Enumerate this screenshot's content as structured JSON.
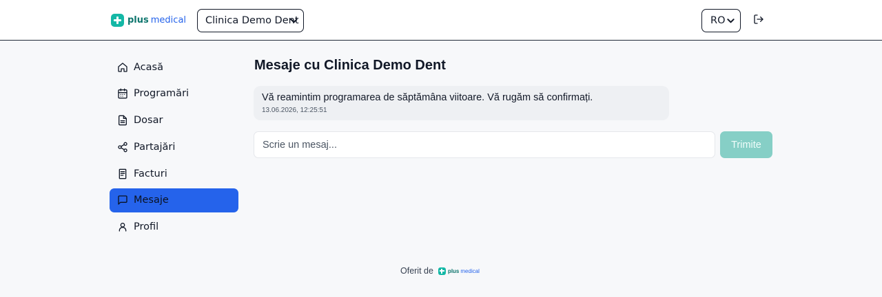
{
  "header": {
    "logo_plus": "plus",
    "logo_medical": "medical",
    "clinic_selected": "Clinica Demo Dent",
    "language_selected": "RO",
    "logout_icon": "logout-icon"
  },
  "sidebar": {
    "items": [
      {
        "label": "Acasă",
        "icon": "home-icon",
        "active": false
      },
      {
        "label": "Programări",
        "icon": "calendar-icon",
        "active": false
      },
      {
        "label": "Dosar",
        "icon": "document-icon",
        "active": false
      },
      {
        "label": "Partajări",
        "icon": "share-icon",
        "active": false
      },
      {
        "label": "Facturi",
        "icon": "invoice-icon",
        "active": false
      },
      {
        "label": "Mesaje",
        "icon": "message-icon",
        "active": true
      },
      {
        "label": "Profil",
        "icon": "user-icon",
        "active": false
      }
    ]
  },
  "main": {
    "title": "Mesaje cu Clinica Demo Dent",
    "messages": [
      {
        "text": "Vă reamintim programarea de săptămâna viitoare. Vă rugăm să confirmați.",
        "timestamp": "13.06.2026, 12:25:51"
      }
    ],
    "input_placeholder": "Scrie un mesaj...",
    "send_label": "Trimite"
  },
  "footer": {
    "offered_by": "Oferit de",
    "logo_plus": "plus",
    "logo_medical": "medical"
  },
  "colors": {
    "accent": "#2563eb",
    "brand_teal": "#14b8a6",
    "send_button": "#86cfc6",
    "background": "#f7f8fa"
  }
}
